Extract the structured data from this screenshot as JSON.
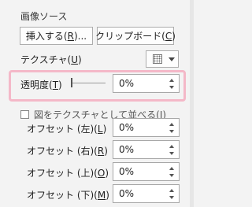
{
  "image_source": {
    "title": "画像ソース",
    "insert_button": {
      "text": "挿入する(",
      "key": "R",
      "suffix": ")..."
    },
    "clipboard_button": {
      "text": "クリップボード(",
      "key": "C",
      "suffix": ")"
    }
  },
  "texture": {
    "label": "テクスチャ(",
    "key": "U",
    "suffix": ")",
    "picker_icon": "texture-swatch-icon"
  },
  "transparency": {
    "label": "透明度(",
    "key": "T",
    "suffix": ")",
    "value": "0%",
    "slider_value": 0
  },
  "tile_checkbox": {
    "label": "図をテクスチャとして並べる(",
    "key": "I",
    "suffix": ")",
    "checked": false
  },
  "offsets": [
    {
      "label": "オフセット (左)(",
      "key": "L",
      "suffix": ")",
      "value": "0%"
    },
    {
      "label": "オフセット (右)(",
      "key": "R",
      "suffix": ")",
      "value": "0%"
    },
    {
      "label": "オフセット (上)(",
      "key": "O",
      "suffix": ")",
      "value": "0%"
    },
    {
      "label": "オフセット (下)(",
      "key": "M",
      "suffix": ")",
      "value": "0%"
    }
  ],
  "colors": {
    "highlight": "#f4b8c8"
  }
}
